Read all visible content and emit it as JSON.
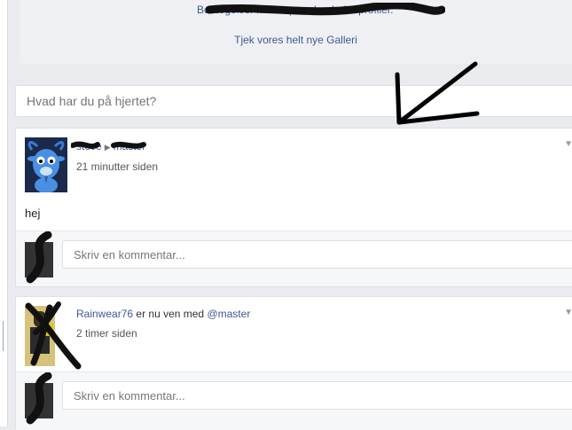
{
  "banner": {
    "obscured_text": "Bevægelser mere spændende for profiler.",
    "gallery_link": "Tjek vores helt nye Galleri"
  },
  "composer": {
    "placeholder": "Hvad har du på hjertet?"
  },
  "posts": [
    {
      "author": "steve",
      "target": "master",
      "time": "21 minutter siden",
      "text": "hej",
      "comment_placeholder": "Skriv en kommentar...",
      "avatar_icon": "goat-avatar"
    },
    {
      "author": "Rainwear76",
      "verb": "er nu ven med",
      "target": "@master",
      "time": "2 timer siden",
      "comment_placeholder": "Skriv en kommentar...",
      "avatar_icon": "user-photo-avatar"
    }
  ],
  "colors": {
    "link": "#3b5998",
    "background": "#e9ebee",
    "card": "#ffffff"
  }
}
